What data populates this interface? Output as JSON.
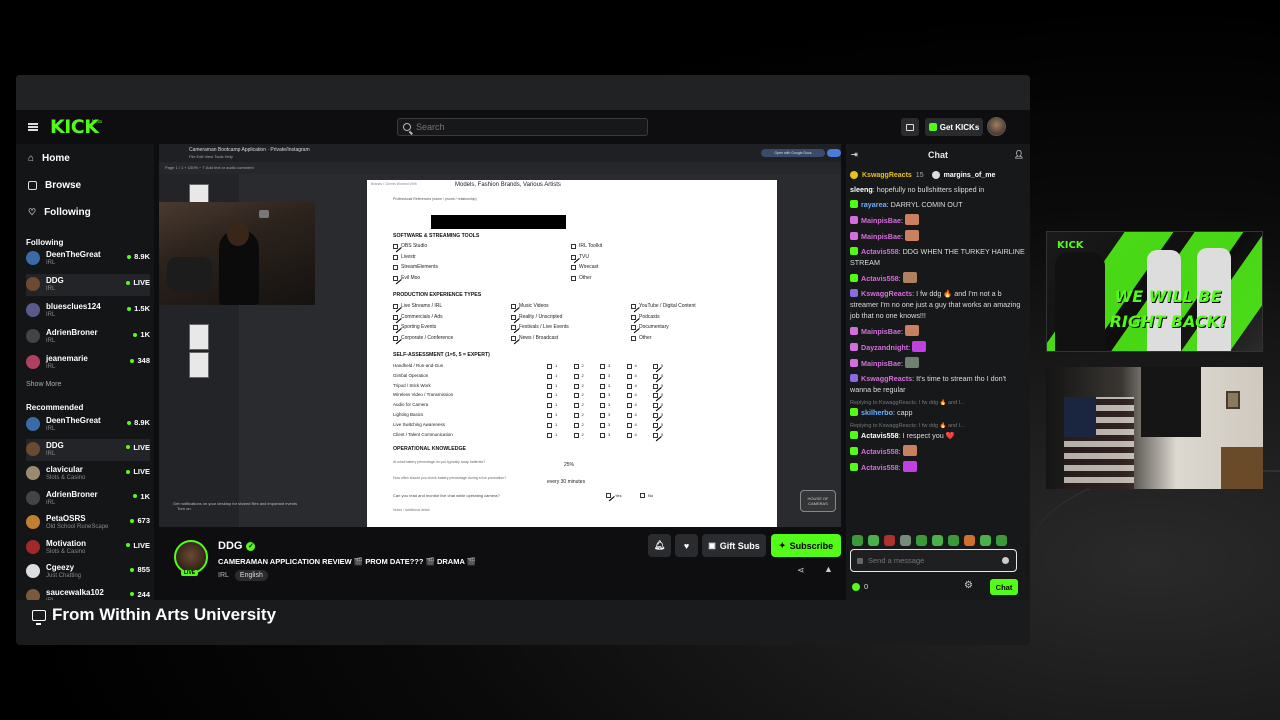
{
  "header": {
    "logo": "KICK",
    "logo_beta": "beta",
    "search_placeholder": "Search",
    "get_kicks": "Get KICKs"
  },
  "nav": [
    {
      "label": "Home",
      "icon": "home-icon"
    },
    {
      "label": "Browse",
      "icon": "browse-icon"
    },
    {
      "label": "Following",
      "icon": "heart-icon"
    }
  ],
  "sidebar": {
    "following_title": "Following",
    "following": [
      {
        "name": "DeenTheGreat",
        "sub": "IRL",
        "viewers": "8.9K",
        "color": "#3a6aa8"
      },
      {
        "name": "DDG",
        "sub": "IRL",
        "viewers": "LIVE",
        "color": "#6a4a30"
      },
      {
        "name": "bluesclues124",
        "sub": "IRL",
        "viewers": "1.5K",
        "color": "#5a5a8a"
      },
      {
        "name": "AdrienBroner",
        "sub": "IRL",
        "viewers": "1K",
        "color": "#444"
      },
      {
        "name": "jeanemarie",
        "sub": "IRL",
        "viewers": "348",
        "color": "#b04060"
      }
    ],
    "show_more": "Show More",
    "recommended_title": "Recommended",
    "recommended": [
      {
        "name": "DeenTheGreat",
        "sub": "IRL",
        "viewers": "8.9K",
        "color": "#3a6aa8"
      },
      {
        "name": "DDG",
        "sub": "IRL",
        "viewers": "LIVE",
        "color": "#6a4a30"
      },
      {
        "name": "clavicular",
        "sub": "Slots & Casino",
        "viewers": "LIVE",
        "color": "#9a8a70"
      },
      {
        "name": "AdrienBroner",
        "sub": "IRL",
        "viewers": "1K",
        "color": "#444"
      },
      {
        "name": "PetaOSRS",
        "sub": "Old School RuneScape",
        "viewers": "673",
        "color": "#c08030"
      },
      {
        "name": "Motivation",
        "sub": "Slots & Casino",
        "viewers": "LIVE",
        "color": "#a02a2a"
      },
      {
        "name": "Cgeezy",
        "sub": "Just Chatting",
        "viewers": "855",
        "color": "#ddd"
      },
      {
        "name": "saucewalka102",
        "sub": "IRL",
        "viewers": "244",
        "color": "#7a5a3a"
      }
    ]
  },
  "video": {
    "doc_title": "Cameraman Bootcamp Application · Private/Instagram",
    "doc_menu": "File   Edit   View   Tools   Help",
    "doc_tools": "Page  1  / 1      +     100%     −       T  Add text or audio comment",
    "doc_share": "Open with Google Docs",
    "notification": "Get notifications on your desktop for shared files and important events",
    "notification_btn": "Turn on",
    "watermark": "HOUSE OF CAMERAS",
    "form": {
      "top_line": "Models, Fashion Brands, Various Artists",
      "brands_label": "Brands / Clients Worked With",
      "references_label": "Professional References (name / phone / relationship)",
      "software_heading": "SOFTWARE & STREAMING TOOLS",
      "software_left": [
        "OBS Studio",
        "Livestr",
        "StreamElements",
        "Evil Moo"
      ],
      "software_right": [
        "IRL Toolkit",
        "TVU",
        "Wirecast",
        "Other"
      ],
      "production_heading": "PRODUCTION EXPERIENCE TYPES",
      "prod_col1": [
        "Live Streams / IRL",
        "Commercials / Ads",
        "Sporting Events",
        "Corporate / Conference"
      ],
      "prod_col2": [
        "Music Videos",
        "Reality / Unscripted",
        "Festivals / Live Events",
        "News / Broadcast"
      ],
      "prod_col3": [
        "YouTube / Digital Content",
        "Podcasts",
        "Documentary",
        "Other"
      ],
      "self_heading": "SELF-ASSESSMENT (1=5, 5 = EXPERT)",
      "self_items": [
        "Handheld / Run-and-Gun",
        "Gimbal Operation",
        "Tripod / Stick Work",
        "Wireless Video / Transmission",
        "Audio for Camera",
        "Lighting Basics",
        "Live Switching Awareness",
        "Client / Talent Communication"
      ],
      "self_scale": [
        "1",
        "2",
        "3",
        "4",
        "5"
      ],
      "op_heading": "OPERATIONAL KNOWLEDGE",
      "op_q1": "At what battery percentage do you typically swap batteries?",
      "op_a1": "25%",
      "op_q2": "How often should you check battery percentage during a live production?",
      "op_a2": "every 30 minutes",
      "op_q3": "Can you read and monitor live chat while operating camera?",
      "op_yes": "Yes",
      "op_no": "No",
      "op_q4": "Notes / additional detail"
    }
  },
  "stream": {
    "name": "DDG",
    "live_label": "LIVE",
    "title": "CAMERAMAN APPLICATION REVIEW 🎬 PROM DATE??? 🎬 DRAMA 🎬",
    "category": "IRL",
    "language": "English",
    "gift_subs": "Gift Subs",
    "subscribe": "Subscribe"
  },
  "chat": {
    "title": "Chat",
    "pinned_1": "KswaggReacts",
    "pinned_1_count": "15",
    "pinned_2": "margins_of_me",
    "messages": [
      {
        "user": "sleeng",
        "text": "hopefully no bullshitters slipped in",
        "color": "#ffffff",
        "badge": "",
        "reply": ""
      },
      {
        "user": "rayarea",
        "text": "DARRYL COMIN OUT",
        "color": "#6ab0ff",
        "badge": "#53fc18",
        "reply": ""
      },
      {
        "user": "MainpisBae",
        "text": "",
        "color": "#d66ddf",
        "badge": "#d66ddf",
        "reply": "",
        "emote": "#c88060"
      },
      {
        "user": "MainpisBae",
        "text": "",
        "color": "#d66ddf",
        "badge": "#d66ddf",
        "reply": "",
        "emote": "#c88060"
      },
      {
        "user": "Actavis558",
        "text": "DDG WHEN THE TURKEY HAIRLINE STREAM",
        "color": "#d66ddf",
        "badge": "#53fc18",
        "reply": ""
      },
      {
        "user": "Actavis558",
        "text": "",
        "color": "#d66ddf",
        "badge": "#53fc18",
        "reply": "",
        "emote": "#b08060"
      },
      {
        "user": "KswaggReacts",
        "text": "I fw ddg 🔥 and I'm not a b streamer I'm no one just a guy that works an amazing job that no one knows!!!",
        "color": "#d66ddf",
        "badge": "#8a6adf",
        "reply": ""
      },
      {
        "user": "MainpisBae",
        "text": "",
        "color": "#d66ddf",
        "badge": "#d66ddf",
        "reply": "",
        "emote": "#c88060"
      },
      {
        "user": "Dayzandnight",
        "text": "",
        "color": "#d66ddf",
        "badge": "#d66ddf",
        "reply": "",
        "emote": "#c040e0"
      },
      {
        "user": "MainpisBae",
        "text": "",
        "color": "#d66ddf",
        "badge": "#d66ddf",
        "reply": "",
        "emote": "#708070"
      },
      {
        "user": "KswaggReacts",
        "text": "It's time to stream tho I don't wanna be regular",
        "color": "#d66ddf",
        "badge": "#8a6adf",
        "reply": ""
      },
      {
        "user": "skilherbo",
        "text": "capp",
        "color": "#6ab0ff",
        "badge": "#53fc18",
        "reply": "Replying to KswaggReacts: I fw ddg 🔥 and I..."
      },
      {
        "user": "Actavis558",
        "text": "I respect you ❤️",
        "color": "#ffffff",
        "badge": "#53fc18",
        "reply": "Replying to KswaggReacts: I fw ddg 🔥 and I..."
      },
      {
        "user": "Actavis558",
        "text": "",
        "color": "#d66ddf",
        "badge": "#53fc18",
        "reply": "",
        "emote": "#c88060"
      },
      {
        "user": "Actavis558",
        "text": "",
        "color": "#d66ddf",
        "badge": "#53fc18",
        "reply": "",
        "emote": "#c040e0"
      }
    ],
    "input_placeholder": "Send a message",
    "kicks_count": "0",
    "send_label": "Chat"
  },
  "overlay": {
    "brb_logo": "KICK",
    "brb_text": "WE WILL BE RIGHT BACK!"
  },
  "caption": "From Within Arts University"
}
